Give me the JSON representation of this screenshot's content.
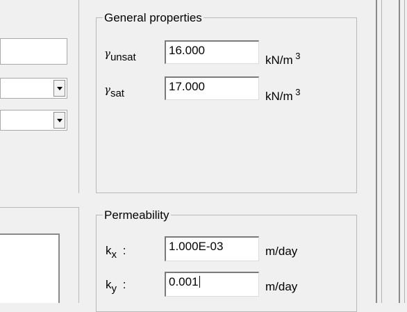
{
  "general_properties": {
    "title": "General properties",
    "gamma_unsat": {
      "symbol": "γ",
      "subscript": "unsat",
      "value": "16.000",
      "unit": "kN/m",
      "unit_exp": "3"
    },
    "gamma_sat": {
      "symbol": "γ",
      "subscript": "sat",
      "value": "17.000",
      "unit": "kN/m",
      "unit_exp": "3"
    }
  },
  "permeability": {
    "title": "Permeability",
    "kx": {
      "symbol": "k",
      "subscript": "x",
      "separator": ":",
      "value": "1.000E-03",
      "unit": "m/day"
    },
    "ky": {
      "symbol": "k",
      "subscript": "y",
      "separator": ":",
      "value": "0.001",
      "unit": "m/day"
    }
  }
}
